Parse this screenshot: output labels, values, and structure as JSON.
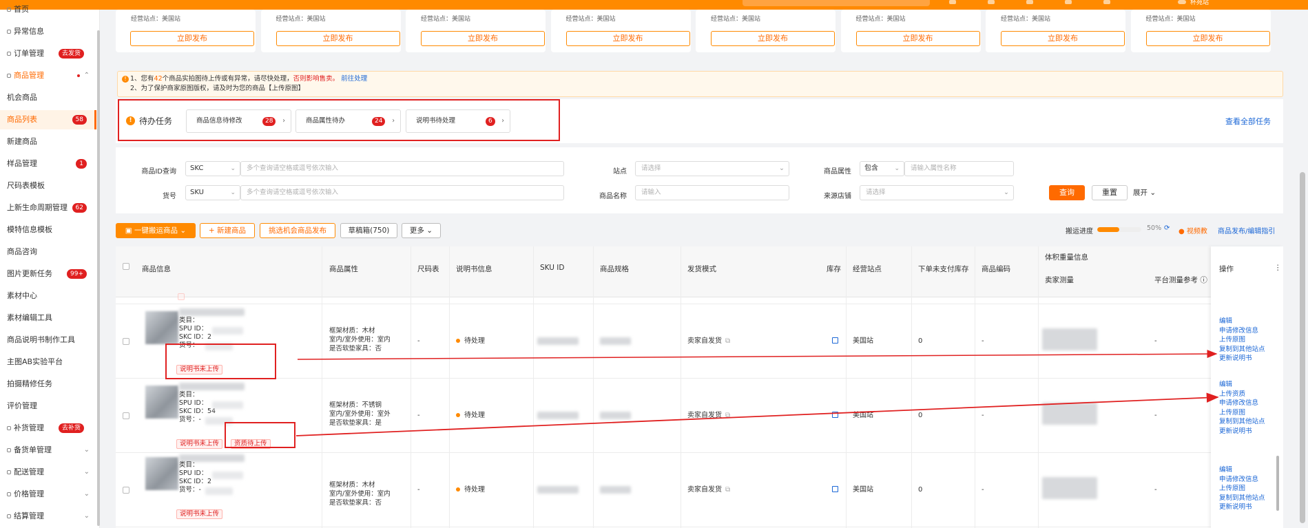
{
  "topbar": {
    "user_label": "杯苑站"
  },
  "sidebar": {
    "items": [
      {
        "label": "首页",
        "badge": ""
      },
      {
        "label": "异常信息",
        "badge": ""
      },
      {
        "label": "订单管理",
        "badge": "去发货"
      },
      {
        "label": "商品管理",
        "badge": ""
      },
      {
        "label": "机会商品",
        "badge": ""
      },
      {
        "label": "商品列表",
        "badge": "58"
      },
      {
        "label": "新建商品",
        "badge": ""
      },
      {
        "label": "样品管理",
        "badge": "1"
      },
      {
        "label": "尺码表模板",
        "badge": ""
      },
      {
        "label": "上新生命周期管理",
        "badge": "62"
      },
      {
        "label": "模特信息模板",
        "badge": ""
      },
      {
        "label": "商品咨询",
        "badge": ""
      },
      {
        "label": "图片更新任务",
        "badge": "99+"
      },
      {
        "label": "素材中心",
        "badge": ""
      },
      {
        "label": "素材编辑工具",
        "badge": ""
      },
      {
        "label": "商品说明书制作工具",
        "badge": ""
      },
      {
        "label": "主图AB实验平台",
        "badge": ""
      },
      {
        "label": "拍摄精修任务",
        "badge": ""
      },
      {
        "label": "评价管理",
        "badge": ""
      },
      {
        "label": "补货管理",
        "badge": "去补货"
      },
      {
        "label": "备货单管理",
        "badge": ""
      },
      {
        "label": "配送管理",
        "badge": ""
      },
      {
        "label": "价格管理",
        "badge": ""
      },
      {
        "label": "结算管理",
        "badge": ""
      }
    ]
  },
  "shop_cards": {
    "meta_label": "经营站点：美国站",
    "button_label": "立即发布",
    "count": 8
  },
  "notice": {
    "line1_a": "1、您有",
    "line1_count": "42",
    "line1_b": "个商品实拍图待上传或有异常，请尽快处理，",
    "line1_warn": "否则影响售卖。",
    "line1_link": "前往处理",
    "line2": "2、为了保护商家原图版权，请及时为您的商品【上传原图】"
  },
  "todo": {
    "title": "待办任务",
    "chips": [
      {
        "label": "商品信息待修改",
        "count": "28"
      },
      {
        "label": "商品属性待办",
        "count": "24"
      },
      {
        "label": "说明书待处理",
        "count": "6"
      }
    ],
    "view_all": "查看全部任务"
  },
  "filters": {
    "product_id_label": "商品ID查询",
    "product_id_type": "SKC",
    "product_id_placeholder": "多个查询请空格或逗号依次输入",
    "sku_label": "货号",
    "sku_type": "SKU",
    "sku_placeholder": "多个查询请空格或逗号依次输入",
    "site_label": "站点",
    "site_placeholder": "请选择",
    "name_label": "商品名称",
    "name_placeholder": "请输入",
    "attr_label": "商品属性",
    "attr_mode": "包含",
    "attr_placeholder": "请输入属性名称",
    "source_label": "来源店铺",
    "source_placeholder": "请选择",
    "query_btn": "查询",
    "reset_btn": "重置",
    "expand_btn": "展开"
  },
  "toolbar": {
    "move_btn": "一键搬运商品",
    "new_btn": "+ 新建商品",
    "opp_btn": "挑选机会商品发布",
    "draft_btn": "草稿箱(750)",
    "more_btn": "更多",
    "progress_label": "搬运进度",
    "progress_pct": "50%",
    "progress_value": 0.5,
    "help_link": "视频教",
    "publish_link": "商品发布/编辑指引"
  },
  "table": {
    "headers": {
      "info": "商品信息",
      "attr": "商品属性",
      "size": "尺码表",
      "manual": "说明书信息",
      "skuid": "SKU ID",
      "spec": "商品规格",
      "ship": "发货模式",
      "stock": "库存",
      "site": "经营站点",
      "unpaid": "下单未支付库存",
      "code": "商品编码",
      "volume": "体积重量信息",
      "seller_measure": "卖家测量",
      "platform_measure": "平台测量参考",
      "ops": "操作"
    },
    "rows": [
      {
        "category": "类目：",
        "spu": "SPU ID：",
        "skc": "SKC ID：2",
        "sku": "货号：",
        "tags": [
          "说明书未上传"
        ],
        "attr_lines": [
          "框架材质：木材",
          "室内/室外使用：室内",
          "是否软垫家具：否"
        ],
        "size": "-",
        "manual_status": "待处理",
        "ship_mode": "卖家自发货",
        "site": "美国站",
        "unpaid": "0",
        "code": "-",
        "platform": "-",
        "ops": [
          "编辑",
          "申请修改信息",
          "上传原图",
          "复制到其他站点",
          "更新说明书"
        ]
      },
      {
        "category": "类目：",
        "spu": "SPU ID：",
        "skc": "SKC ID：54",
        "sku": "货号：-",
        "tags": [
          "说明书未上传",
          "资质待上传"
        ],
        "attr_lines": [
          "框架材质：不锈钢",
          "室内/室外使用：室外",
          "是否软垫家具：是"
        ],
        "size": "-",
        "manual_status": "待处理",
        "ship_mode": "卖家自发货",
        "site": "美国站",
        "unpaid": "0",
        "code": "-",
        "platform": "-",
        "ops": [
          "编辑",
          "上传资质",
          "申请修改信息",
          "上传原图",
          "复制到其他站点",
          "更新说明书"
        ]
      },
      {
        "category": "类目：",
        "spu": "SPU ID：",
        "skc": "SKC ID：2",
        "sku": "货号：-",
        "tags": [
          "说明书未上传"
        ],
        "attr_lines": [
          "框架材质：木材",
          "室内/室外使用：室内",
          "是否软垫家具：否"
        ],
        "size": "-",
        "manual_status": "待处理",
        "ship_mode": "卖家自发货",
        "site": "美国站",
        "unpaid": "0",
        "code": "-",
        "platform": "-",
        "ops": [
          "编辑",
          "申请修改信息",
          "上传原图",
          "复制到其他站点",
          "更新说明书"
        ]
      }
    ]
  },
  "colors": {
    "brand": "#ff8a00",
    "accent": "#ff6a00",
    "alert": "#e02020",
    "link": "#1a66d6"
  }
}
